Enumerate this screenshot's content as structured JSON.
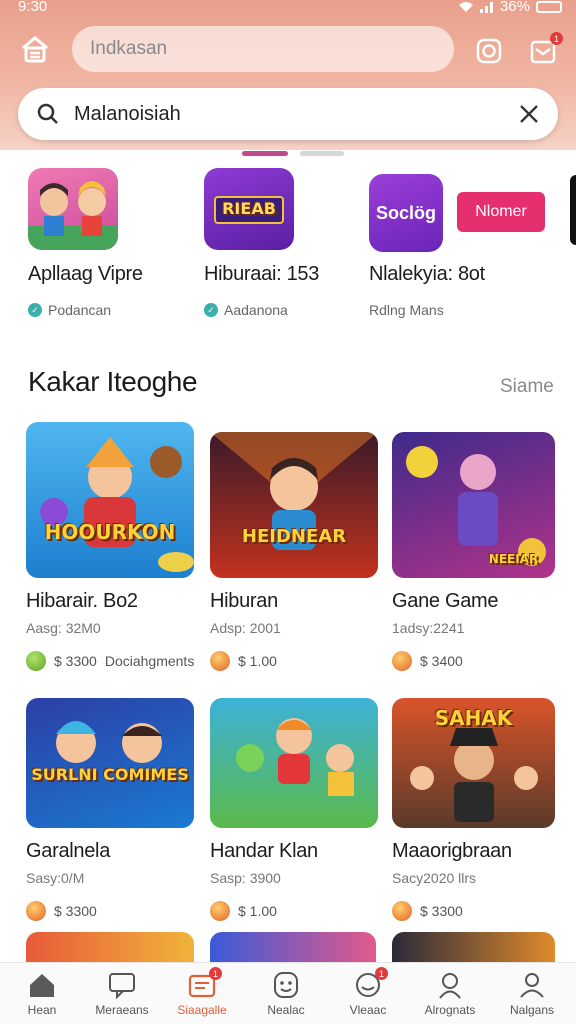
{
  "status_bar": {
    "time": "9:30",
    "battery": "36%"
  },
  "header": {
    "top_input_placeholder": "Indkasan",
    "notif_badge": "1",
    "search_query": "Malanoisiah"
  },
  "featured": [
    {
      "name": "Apllaag Vipre",
      "sub": "Podancan"
    },
    {
      "name": "Hiburaai: 153",
      "sub": "Aadanona",
      "icon_text": "RIEAB"
    },
    {
      "name": "Nlalekyia: 8ot",
      "sub": "Rdlng Mans",
      "icon_text": "Soclög",
      "button": "Nlomer"
    }
  ],
  "section": {
    "title": "Kakar Iteoghe",
    "more": "Siame"
  },
  "games": [
    {
      "title": "Hibarair. Bo2",
      "sub": "Aasg: 32M0",
      "price": "$ 3300",
      "extra": "Dociahgments",
      "thumb_text": "HOOURKON",
      "coin": "green"
    },
    {
      "title": "Hiburan",
      "sub": "Adsp: 2001",
      "price": "$ 1.00",
      "thumb_text": "HEIDNEAR",
      "coin": "orange"
    },
    {
      "title": "Gane Game",
      "sub": "1adsy:2241",
      "price": "$ 3400",
      "thumb_text": "NEEIAR",
      "coin": "orange"
    },
    {
      "title": "Garalnela",
      "sub": "Sasy:0/M",
      "price": "$ 3300",
      "thumb_text": "SURLNI COMIMES",
      "coin": "orange"
    },
    {
      "title": "Handar Klan",
      "sub": "Sasp: 3900",
      "price": "$ 1.00",
      "thumb_text": "",
      "coin": "orange"
    },
    {
      "title": "Maaorigbraan",
      "sub": "Sacy2020 llrs",
      "price": "$ 3300",
      "thumb_text": "SAHAK",
      "coin": "orange"
    }
  ],
  "bottom_nav": [
    {
      "label": "Hean",
      "active": false
    },
    {
      "label": "Meraeans",
      "active": false
    },
    {
      "label": "Siaagalle",
      "active": true,
      "badge": "1"
    },
    {
      "label": "Nealac",
      "active": false
    },
    {
      "label": "Vleaac",
      "active": false,
      "badge": "1"
    },
    {
      "label": "Alrognats",
      "active": false
    },
    {
      "label": "Nalgans",
      "active": false
    }
  ],
  "colors": {
    "accent": "#e62f6e",
    "header_bg": "#eea592",
    "nav_active": "#e0603a"
  }
}
